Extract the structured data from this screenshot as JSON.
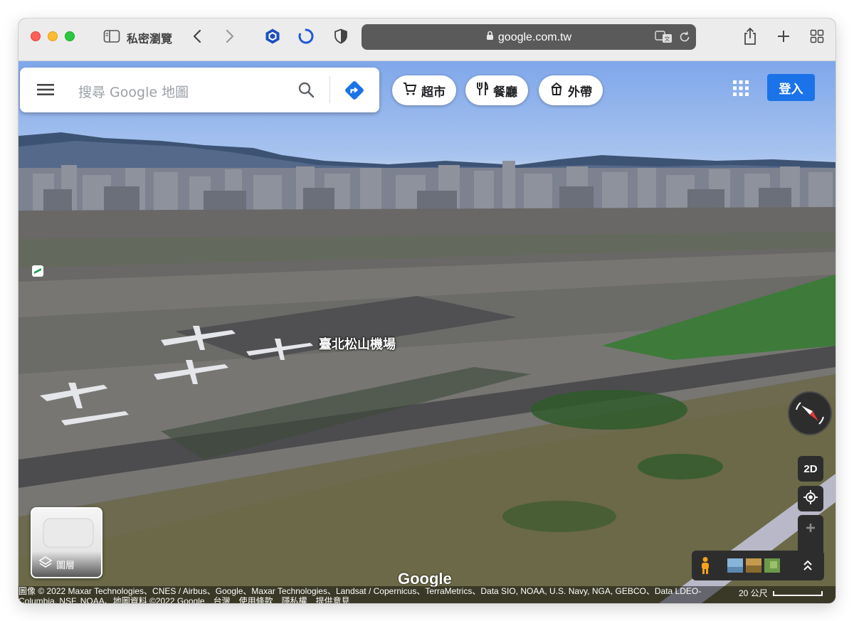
{
  "browser": {
    "private_label": "私密瀏覽",
    "url": "google.com.tw"
  },
  "search": {
    "placeholder": "搜尋 Google 地圖"
  },
  "chips": [
    {
      "label": "超市",
      "icon": "cart-icon"
    },
    {
      "label": "餐廳",
      "icon": "restaurant-icon"
    },
    {
      "label": "外帶",
      "icon": "takeout-icon"
    }
  ],
  "header": {
    "login_label": "登入"
  },
  "map": {
    "place_label": "臺北松山機場",
    "layer_label": "圖層",
    "mode_2d": "2D",
    "google_logo": "Google",
    "attribution_1": "圖像 © 2022 Maxar Technologies、CNES / Airbus、Google、Maxar Technologies、Landsat / Copernicus、TerraMetrics、Data SIO, NOAA, U.S. Navy, NGA, GEBCO、Data LDEO-",
    "attribution_2": "Columbia, NSF, NOAA、地圖資料 ©2022 Google　台灣　使用條款　隱私權　提供意見",
    "scale_label": "20 公尺"
  },
  "colors": {
    "login_button": "#1a73e8",
    "directions": "#1a73e8",
    "urlbar": "#5a5a5a"
  }
}
